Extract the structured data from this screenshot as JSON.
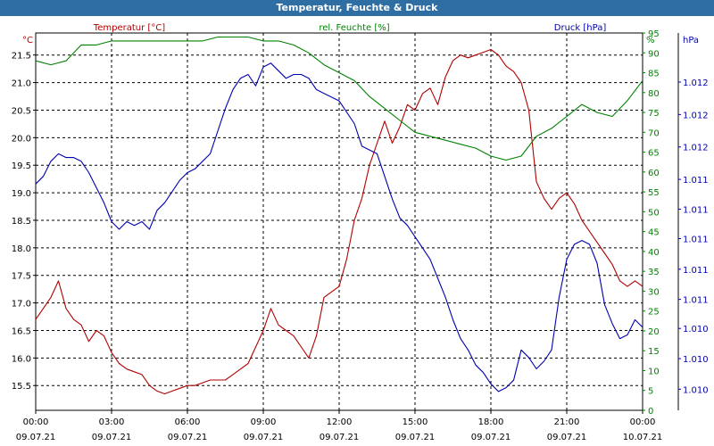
{
  "chart_data": {
    "type": "line",
    "title": "Temperatur, Feuchte & Druck",
    "x_ticks": [
      {
        "time": "00:00",
        "date": "09.07.21"
      },
      {
        "time": "03:00",
        "date": "09.07.21"
      },
      {
        "time": "06:00",
        "date": "09.07.21"
      },
      {
        "time": "09:00",
        "date": "09.07.21"
      },
      {
        "time": "12:00",
        "date": "09.07.21"
      },
      {
        "time": "15:00",
        "date": "09.07.21"
      },
      {
        "time": "18:00",
        "date": "09.07.21"
      },
      {
        "time": "21:00",
        "date": "09.07.21"
      },
      {
        "time": "00:00",
        "date": "10.07.21"
      }
    ],
    "x_range_hours": [
      0,
      24
    ],
    "grid": true,
    "axes": {
      "temperature": {
        "label": "Temperatur [°C]",
        "unit": "°C",
        "side": "left",
        "color": "#b00000",
        "range": [
          15.05,
          21.9
        ],
        "ticks": [
          "15.5",
          "16.0",
          "16.5",
          "17.0",
          "17.5",
          "18.0",
          "18.5",
          "19.0",
          "19.5",
          "20.0",
          "20.5",
          "21.0",
          "21.5"
        ],
        "tick_values": [
          15.5,
          16.0,
          16.5,
          17.0,
          17.5,
          18.0,
          18.5,
          19.0,
          19.5,
          20.0,
          20.5,
          21.0,
          21.5
        ]
      },
      "humidity": {
        "label": "rel. Feuchte [%]",
        "unit": "%",
        "side": "right",
        "color": "#008000",
        "range": [
          0,
          95
        ],
        "ticks": [
          "0",
          "5",
          "10",
          "15",
          "20",
          "25",
          "30",
          "35",
          "40",
          "45",
          "50",
          "55",
          "60",
          "65",
          "70",
          "75",
          "80",
          "85",
          "90",
          "95"
        ],
        "tick_values": [
          0,
          5,
          10,
          15,
          20,
          25,
          30,
          35,
          40,
          45,
          50,
          55,
          60,
          65,
          70,
          75,
          80,
          85,
          90,
          95
        ]
      },
      "pressure": {
        "label": "Druck [hPa]",
        "unit": "hPa",
        "side": "right-outer",
        "color": "#0000b0",
        "range": [
          0,
          100
        ],
        "ticks": [
          "1.010",
          "1.010",
          "1.010",
          "1.011",
          "1.011",
          "1.011",
          "1.011",
          "1.011",
          "1.012",
          "1.012",
          "1.012"
        ],
        "tick_values": [
          5.6,
          13.7,
          21.7,
          29.4,
          37.4,
          45.5,
          53.3,
          61.2,
          69.8,
          78.4,
          87.0
        ]
      }
    },
    "series": [
      {
        "name": "Temperatur [°C]",
        "axis": "temperature",
        "color": "#b00000",
        "x": [
          0,
          0.3,
          0.6,
          0.9,
          1.2,
          1.5,
          1.8,
          2.1,
          2.4,
          2.7,
          3.0,
          3.3,
          3.6,
          3.9,
          4.2,
          4.5,
          4.8,
          5.1,
          5.4,
          5.7,
          6.0,
          6.3,
          6.6,
          6.9,
          7.2,
          7.5,
          7.8,
          8.1,
          8.4,
          8.7,
          9.0,
          9.3,
          9.6,
          9.9,
          10.2,
          10.5,
          10.8,
          11.1,
          11.4,
          11.7,
          12.0,
          12.3,
          12.6,
          12.9,
          13.2,
          13.5,
          13.8,
          14.1,
          14.4,
          14.7,
          15.0,
          15.3,
          15.6,
          15.9,
          16.2,
          16.5,
          16.8,
          17.1,
          17.4,
          17.7,
          18.0,
          18.3,
          18.6,
          18.9,
          19.2,
          19.5,
          19.8,
          20.1,
          20.4,
          20.7,
          21.0,
          21.3,
          21.6,
          21.9,
          22.2,
          22.5,
          22.8,
          23.1,
          23.4,
          23.7,
          24.0
        ],
        "values": [
          16.7,
          16.9,
          17.1,
          17.4,
          16.9,
          16.7,
          16.6,
          16.3,
          16.5,
          16.4,
          16.1,
          15.9,
          15.8,
          15.75,
          15.7,
          15.5,
          15.4,
          15.35,
          15.4,
          15.45,
          15.5,
          15.5,
          15.55,
          15.6,
          15.6,
          15.6,
          15.7,
          15.8,
          15.9,
          16.2,
          16.5,
          16.9,
          16.6,
          16.5,
          16.4,
          16.2,
          16.0,
          16.4,
          17.1,
          17.2,
          17.3,
          17.8,
          18.5,
          18.9,
          19.5,
          19.9,
          20.3,
          19.9,
          20.2,
          20.6,
          20.5,
          20.8,
          20.9,
          20.6,
          21.1,
          21.4,
          21.5,
          21.45,
          21.5,
          21.55,
          21.6,
          21.5,
          21.3,
          21.2,
          21.0,
          20.5,
          19.2,
          18.9,
          18.7,
          18.9,
          19.0,
          18.8,
          18.5,
          18.3,
          18.1,
          17.9,
          17.7,
          17.4,
          17.3,
          17.4,
          17.3
        ]
      },
      {
        "name": "rel. Feuchte [%]",
        "axis": "humidity",
        "color": "#008000",
        "x": [
          0,
          0.6,
          1.2,
          1.8,
          2.4,
          3.0,
          3.6,
          4.2,
          4.8,
          5.4,
          6.0,
          6.6,
          7.2,
          7.8,
          8.4,
          9.0,
          9.6,
          10.2,
          10.8,
          11.4,
          12.0,
          12.6,
          13.2,
          13.8,
          14.4,
          15.0,
          15.6,
          16.2,
          16.8,
          17.4,
          18.0,
          18.6,
          19.2,
          19.8,
          20.4,
          21.0,
          21.6,
          22.2,
          22.8,
          23.4,
          24.0
        ],
        "values": [
          88,
          87,
          88,
          92,
          92,
          93,
          93,
          93,
          93,
          93,
          93,
          93,
          94,
          94,
          94,
          93,
          93,
          92,
          90,
          87,
          85,
          83,
          79,
          76,
          73,
          70,
          69,
          68,
          67,
          66,
          64,
          63,
          64,
          69,
          71,
          74,
          77,
          75,
          74,
          78,
          83
        ]
      },
      {
        "name": "Druck [hPa]",
        "axis": "pressure",
        "color": "#0000b0",
        "x": [
          0,
          0.3,
          0.6,
          0.9,
          1.2,
          1.5,
          1.8,
          2.1,
          2.4,
          2.7,
          3.0,
          3.3,
          3.6,
          3.9,
          4.2,
          4.5,
          4.8,
          5.1,
          5.4,
          5.7,
          6.0,
          6.3,
          6.6,
          6.9,
          7.2,
          7.5,
          7.8,
          8.1,
          8.4,
          8.7,
          9.0,
          9.3,
          9.6,
          9.9,
          10.2,
          10.5,
          10.8,
          11.1,
          11.4,
          11.7,
          12.0,
          12.3,
          12.6,
          12.9,
          13.2,
          13.5,
          13.8,
          14.1,
          14.4,
          14.7,
          15.0,
          15.3,
          15.6,
          15.9,
          16.2,
          16.5,
          16.8,
          17.1,
          17.4,
          17.7,
          18.0,
          18.3,
          18.6,
          18.9,
          19.2,
          19.5,
          19.8,
          20.1,
          20.4,
          20.7,
          21.0,
          21.3,
          21.6,
          21.9,
          22.2,
          22.5,
          22.8,
          23.1,
          23.4,
          23.7,
          24.0
        ],
        "values": [
          60,
          62,
          66,
          68,
          67,
          67,
          66,
          63,
          59,
          55,
          50,
          48,
          50,
          49,
          50,
          48,
          53,
          55,
          58,
          61,
          63,
          64,
          66,
          68,
          74,
          80,
          85,
          88,
          89,
          86,
          91,
          92,
          90,
          88,
          89,
          89,
          88,
          85,
          84,
          83,
          82,
          79,
          76,
          70,
          69,
          68,
          62,
          56,
          51,
          49,
          46,
          43,
          40,
          35,
          30,
          24,
          19,
          16,
          12,
          10,
          7,
          5,
          6,
          8,
          16,
          14,
          11,
          13,
          16,
          30,
          40,
          44,
          45,
          44,
          39,
          28,
          23,
          19,
          20,
          24,
          22
        ]
      }
    ]
  }
}
